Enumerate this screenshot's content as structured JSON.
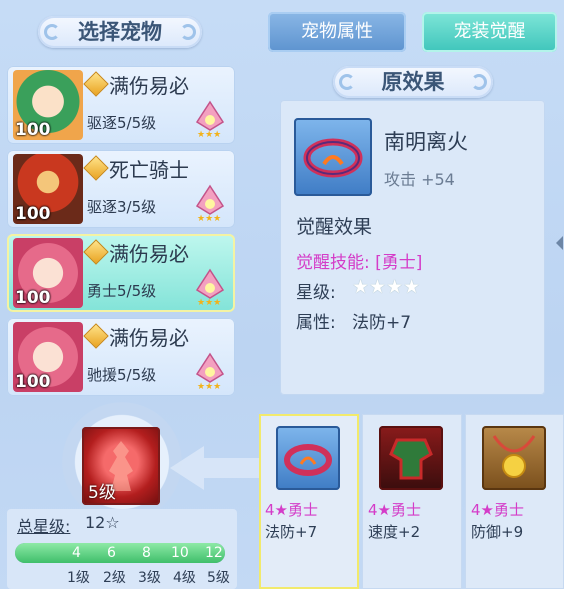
{
  "left_title": "选择宠物",
  "tabs": [
    {
      "label": "宠物属性",
      "active": false
    },
    {
      "label": "宠装觉醒",
      "active": true
    }
  ],
  "pets": [
    {
      "name": "满伤易必",
      "level": "100",
      "stat": "驱逐5/5级",
      "selected": false
    },
    {
      "name": "死亡骑士",
      "level": "100",
      "stat": "驱逐3/5级",
      "selected": false
    },
    {
      "name": "满伤易必",
      "level": "100",
      "stat": "勇士5/5级",
      "selected": true
    },
    {
      "name": "满伤易必",
      "level": "100",
      "stat": "驰援5/5级",
      "selected": false
    }
  ],
  "effect": {
    "section_title": "原效果",
    "item_name": "南明离火",
    "item_stat": "攻击 +54",
    "awaken_title": "觉醒效果",
    "awaken_skill": "觉醒技能: [勇士]",
    "star_label": "星级:",
    "stars": "★★★★",
    "attr_label": "属性:",
    "attr_value": "法防+7"
  },
  "equipment": [
    {
      "stars": "4★勇士",
      "attr": "法防+7",
      "selected": true
    },
    {
      "stars": "4★勇士",
      "attr": "速度+2",
      "selected": false
    },
    {
      "stars": "4★勇士",
      "attr": "防御+9",
      "selected": false
    }
  ],
  "total": {
    "badge_level": "5级",
    "label": "总星级:",
    "value": "12☆",
    "progress_fraction": 1.0,
    "ticks": [
      "4",
      "6",
      "8",
      "10",
      "12"
    ],
    "level_labels": [
      "1级",
      "2级",
      "3级",
      "4级",
      "5级"
    ]
  },
  "colors": {
    "accent_pink": "#d43cc8",
    "tab_active": "#3fc5bb",
    "tab_inactive": "#5d93cf"
  }
}
